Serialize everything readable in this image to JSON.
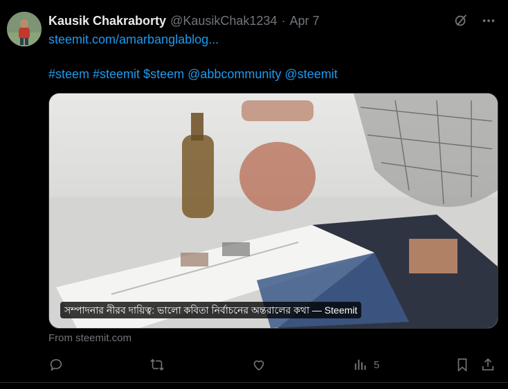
{
  "author": {
    "name": "Kausik Chakraborty",
    "handle": "@KausikChak1234",
    "separator": "·",
    "date": "Apr 7"
  },
  "post": {
    "link_text": "steemit.com/amarbanglablog...",
    "hashtags_line": "#steem #steemit $steem @abbcommunity @steemit"
  },
  "card": {
    "title": "সম্পাদনার নীরব দায়িত্ব: ভালো কবিতা নির্বাচনের অন্তরালের কথা — Steemit",
    "source": "From steemit.com"
  },
  "actions": {
    "views_count": "5"
  },
  "icons": {
    "top": [
      "grok-icon",
      "more-icon"
    ],
    "bar": [
      "reply-icon",
      "repost-icon",
      "like-icon",
      "views-icon",
      "bookmark-icon",
      "share-icon"
    ]
  },
  "colors": {
    "background": "#000000",
    "link": "#1d9bf0",
    "muted": "#71767b",
    "text": "#e7e9ea"
  }
}
